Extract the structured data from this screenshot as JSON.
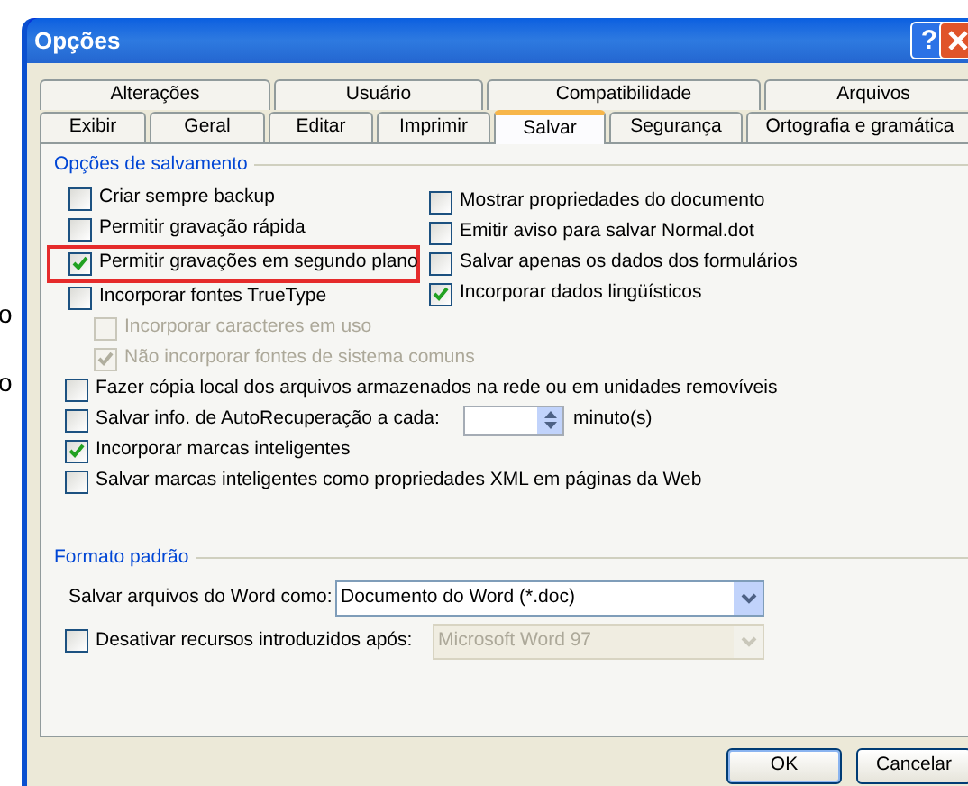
{
  "background_fragments": [
    "o",
    "o"
  ],
  "window": {
    "title": "Opções",
    "help_button": "?"
  },
  "tabs": [
    [
      {
        "label": "Alterações",
        "selected": false
      },
      {
        "label": "Usuário",
        "selected": false
      },
      {
        "label": "Compatibilidade",
        "selected": false
      },
      {
        "label": "Arquivos",
        "selected": false
      }
    ],
    [
      {
        "label": "Exibir",
        "selected": false
      },
      {
        "label": "Geral",
        "selected": false
      },
      {
        "label": "Editar",
        "selected": false
      },
      {
        "label": "Imprimir",
        "selected": false
      },
      {
        "label": "Salvar",
        "selected": true
      },
      {
        "label": "Segurança",
        "selected": false
      },
      {
        "label": "Ortografia e gramática",
        "selected": false
      }
    ]
  ],
  "save_options": {
    "title": "Opções de salvamento",
    "left": [
      {
        "label": "Criar sempre backup",
        "checked": false,
        "highlighted": false
      },
      {
        "label": "Permitir gravação rápida",
        "checked": false,
        "highlighted": false
      },
      {
        "label": "Permitir gravações em segundo plano",
        "checked": true,
        "highlighted": true
      },
      {
        "label": "Incorporar fontes TrueType",
        "checked": false,
        "highlighted": false,
        "children": [
          {
            "label": "Incorporar caracteres em uso",
            "checked": false,
            "disabled": true
          },
          {
            "label": "Não incorporar fontes de sistema comuns",
            "checked": true,
            "disabled": true
          }
        ]
      }
    ],
    "right": [
      {
        "label": "Mostrar propriedades do documento",
        "checked": false
      },
      {
        "label": "Emitir aviso para salvar Normal.dot",
        "checked": false
      },
      {
        "label": "Salvar apenas os dados dos formulários",
        "checked": false
      },
      {
        "label": "Incorporar dados lingüísticos",
        "checked": true
      }
    ],
    "more": [
      {
        "kind": "checkbox",
        "label": "Fazer cópia local dos arquivos armazenados na rede ou em unidades removíveis",
        "checked": false
      },
      {
        "kind": "spin",
        "label": "Salvar info. de AutoRecuperação a cada:",
        "checked": false,
        "unit": "minuto(s)"
      },
      {
        "kind": "checkbox",
        "label": "Incorporar marcas inteligentes",
        "checked": true
      },
      {
        "kind": "checkbox",
        "label": "Salvar marcas inteligentes como propriedades XML em páginas da Web",
        "checked": false
      }
    ]
  },
  "default_format": {
    "title": "Formato padrão",
    "save_as": {
      "label": "Salvar arquivos do Word como:",
      "value": "Documento do Word (*.doc)"
    },
    "disable_features": {
      "label": "Desativar recursos introduzidos após:",
      "checked": false,
      "value": "Microsoft Word 97",
      "disabled": true
    }
  },
  "buttons": [
    {
      "label": "OK"
    },
    {
      "label": "Cancelar"
    }
  ]
}
